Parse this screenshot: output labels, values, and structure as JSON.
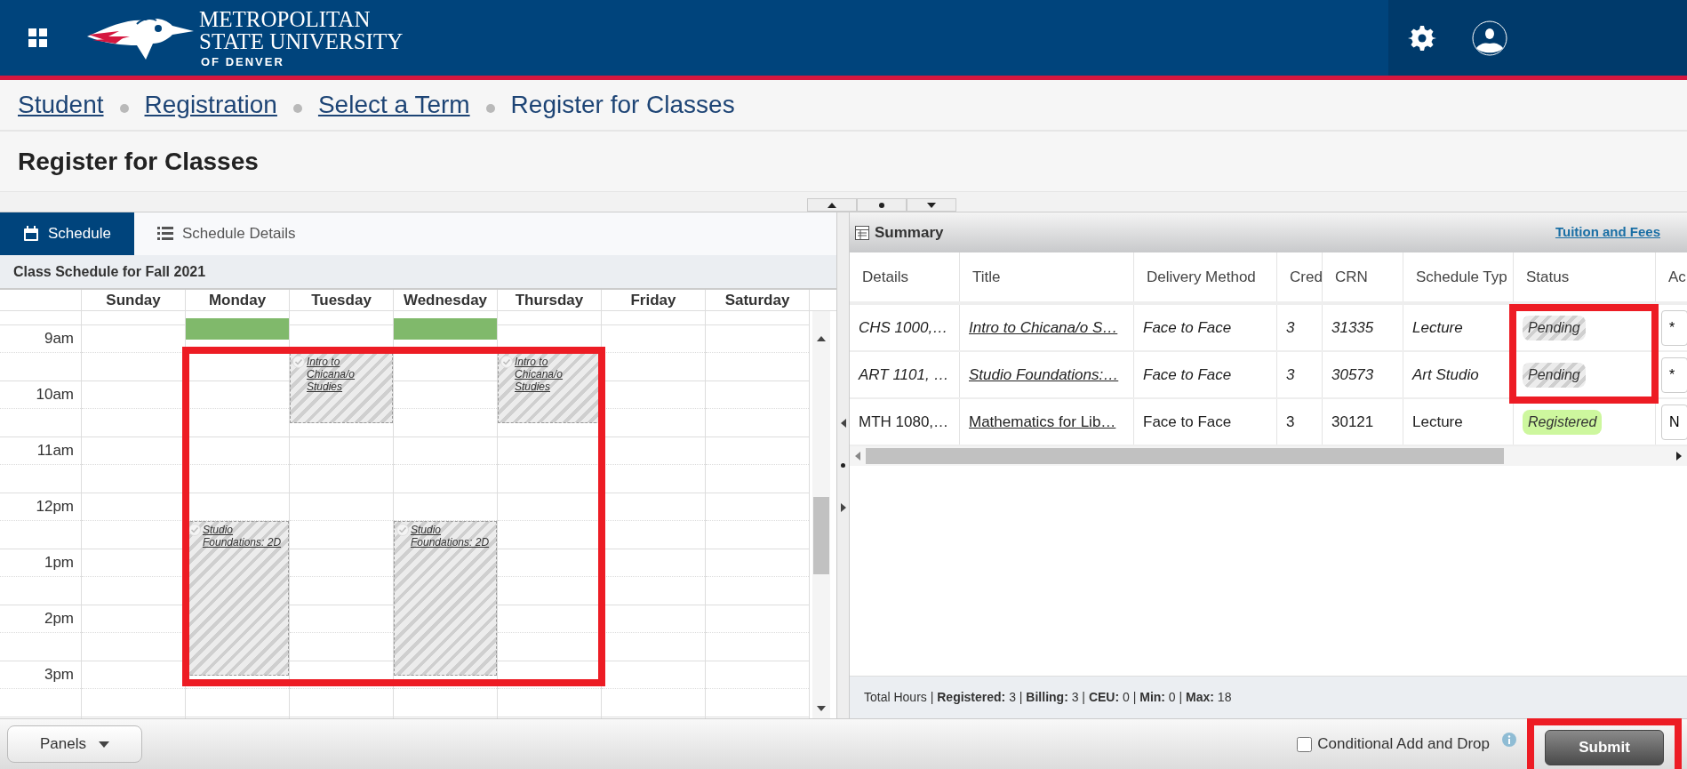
{
  "header": {
    "logo_lines": [
      "METROPOLITAN",
      "STATE UNIVERSITY",
      "OF DENVER"
    ]
  },
  "breadcrumbs": [
    {
      "label": "Student",
      "link": true
    },
    {
      "label": "Registration",
      "link": true
    },
    {
      "label": "Select a Term",
      "link": true
    },
    {
      "label": "Register for Classes",
      "link": false
    }
  ],
  "page_title": "Register for Classes",
  "tabs": [
    {
      "label": "Schedule",
      "selected": true
    },
    {
      "label": "Schedule Details",
      "selected": false
    }
  ],
  "calendar": {
    "title": "Class Schedule for Fall 2021",
    "times": [
      "9am",
      "10am",
      "11am",
      "12pm",
      "1pm",
      "2pm",
      "3pm"
    ],
    "days": [
      {
        "name": "Sunday"
      },
      {
        "name": "Monday",
        "events": [
          {
            "kind": "registered"
          },
          {
            "kind": "pending",
            "title": "Studio Foundations: 2D"
          }
        ]
      },
      {
        "name": "Tuesday",
        "events": [
          {
            "kind": "pending",
            "title": "Intro to Chicana/o Studies"
          }
        ]
      },
      {
        "name": "Wednesday",
        "events": [
          {
            "kind": "registered"
          },
          {
            "kind": "pending",
            "title": "Studio Foundations: 2D"
          }
        ]
      },
      {
        "name": "Thursday",
        "events": [
          {
            "kind": "pending",
            "title": "Intro to Chicana/o Studies"
          }
        ]
      },
      {
        "name": "Friday"
      },
      {
        "name": "Saturday"
      }
    ]
  },
  "summary": {
    "title": "Summary",
    "link": "Tuition and Fees",
    "columns": [
      "Details",
      "Title",
      "Delivery Method",
      "Cred",
      "CRN",
      "Schedule Typ",
      "Status",
      "Ac"
    ],
    "rows": [
      {
        "details": "CHS 1000,…",
        "title": "Intro to Chicana/o S…",
        "delivery": "Face to Face",
        "credits": "3",
        "crn": "31335",
        "schedule_type": "Lecture",
        "status": "Pending",
        "kind": "pending",
        "action": "*"
      },
      {
        "details": "ART 1101, …",
        "title": "Studio Foundations:…",
        "delivery": "Face to Face",
        "credits": "3",
        "crn": "30573",
        "schedule_type": "Art Studio",
        "status": "Pending",
        "kind": "pending",
        "action": "*"
      },
      {
        "details": "MTH 1080,…",
        "title": "Mathematics for Lib…",
        "delivery": "Face to Face",
        "credits": "3",
        "crn": "30121",
        "schedule_type": "Lecture",
        "status": "Registered",
        "kind": "registered",
        "action": "N"
      }
    ],
    "totals": "Total Hours | **Registered:** 3 | **Billing:** 3 | **CEU:** 0 | **Min:** 0 | **Max:** 18"
  },
  "footer": {
    "panels_button": "Panels",
    "conditional": {
      "label": "Conditional Add and Drop",
      "checked": false
    },
    "submit": "Submit"
  }
}
